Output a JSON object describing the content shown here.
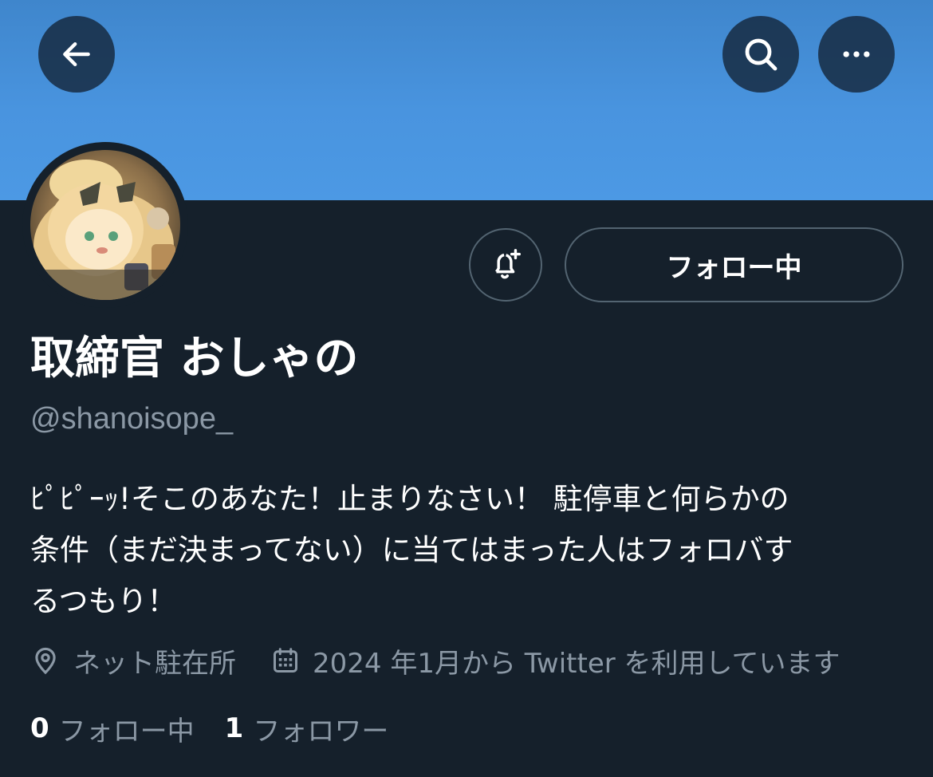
{
  "header": {
    "back_icon": "arrow-left-icon",
    "search_icon": "search-icon",
    "more_icon": "more-horizontal-icon",
    "banner_color": "#4994df"
  },
  "profile": {
    "display_name": "取締官 おしゃの",
    "handle": "@shanoisope_",
    "follow_button_label": "フォロー中",
    "notify_icon": "bell-plus-icon",
    "bio_lines": [
      "ﾋﾟﾋﾟｰｯ!そこのあなた！止まりなさい！ 駐停車と何らかの",
      "条件（まだ決まってない）に当てはまった人はフォロバす",
      "るつもり！"
    ],
    "location": "ネット駐在所",
    "joined": "2024 年1月から Twitter を利用しています",
    "location_icon": "location-pin-icon",
    "calendar_icon": "calendar-icon"
  },
  "stats": {
    "following_count": "0",
    "following_label": "フォロー中",
    "followers_count": "1",
    "followers_label": "フォロワー"
  },
  "colors": {
    "background": "#15202b",
    "secondary_text": "#8b98a5",
    "border": "#536471"
  }
}
